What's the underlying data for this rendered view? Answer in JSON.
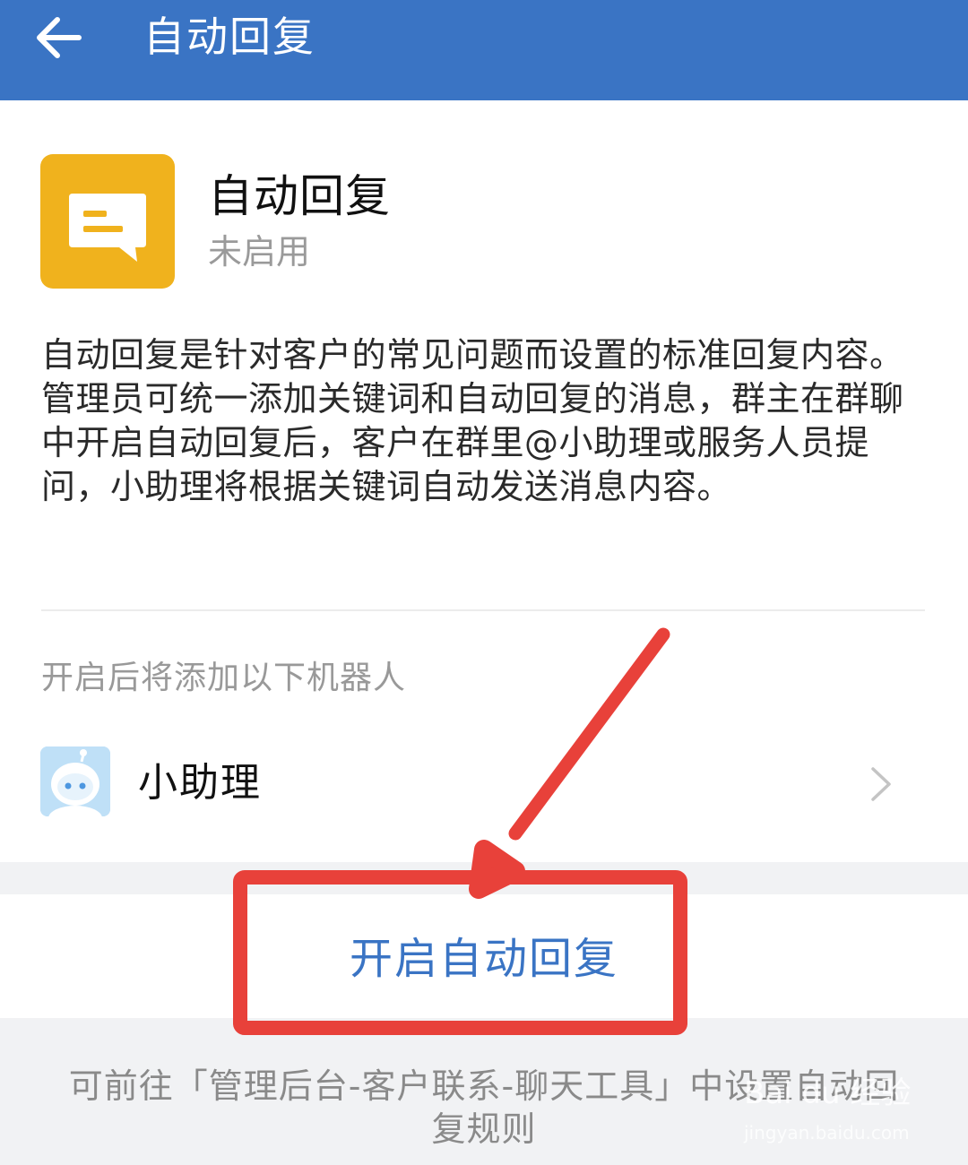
{
  "header": {
    "title": "自动回复"
  },
  "app": {
    "name": "自动回复",
    "status": "未启用",
    "description": "自动回复是针对客户的常见问题而设置的标准回复内容。管理员可统一添加关键词和自动回复的消息，群主在群聊中开启自动回复后，客户在群里@小助理或服务人员提问，小助理将根据关键词自动发送消息内容。"
  },
  "robots": {
    "section_label": "开启后将添加以下机器人",
    "items": [
      {
        "name": "小助理"
      }
    ]
  },
  "actions": {
    "enable_label": "开启自动回复"
  },
  "footer": {
    "note": "可前往「管理后台-客户联系-聊天工具」中设置自动回复规则"
  },
  "watermark": {
    "logo_text": "Bai du 经验",
    "url_text": "jingyan.baidu.com"
  },
  "colors": {
    "header_bg": "#3a74c4",
    "accent": "#3a74c4",
    "app_icon_bg": "#f0b21d",
    "annotation_red": "#e8413a"
  }
}
